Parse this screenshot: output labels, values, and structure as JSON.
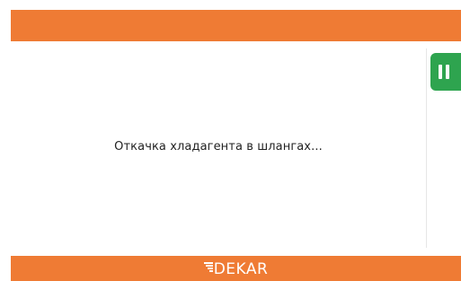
{
  "status": {
    "message": "Откачка хладагента в шлангах..."
  },
  "pause_button": {
    "icon": "pause-icon",
    "color": "#2ea44f"
  },
  "footer": {
    "logo_text": "DEKAR"
  },
  "colors": {
    "brand_orange": "#ef7b34",
    "background": "#ffffff",
    "text": "#222222"
  }
}
